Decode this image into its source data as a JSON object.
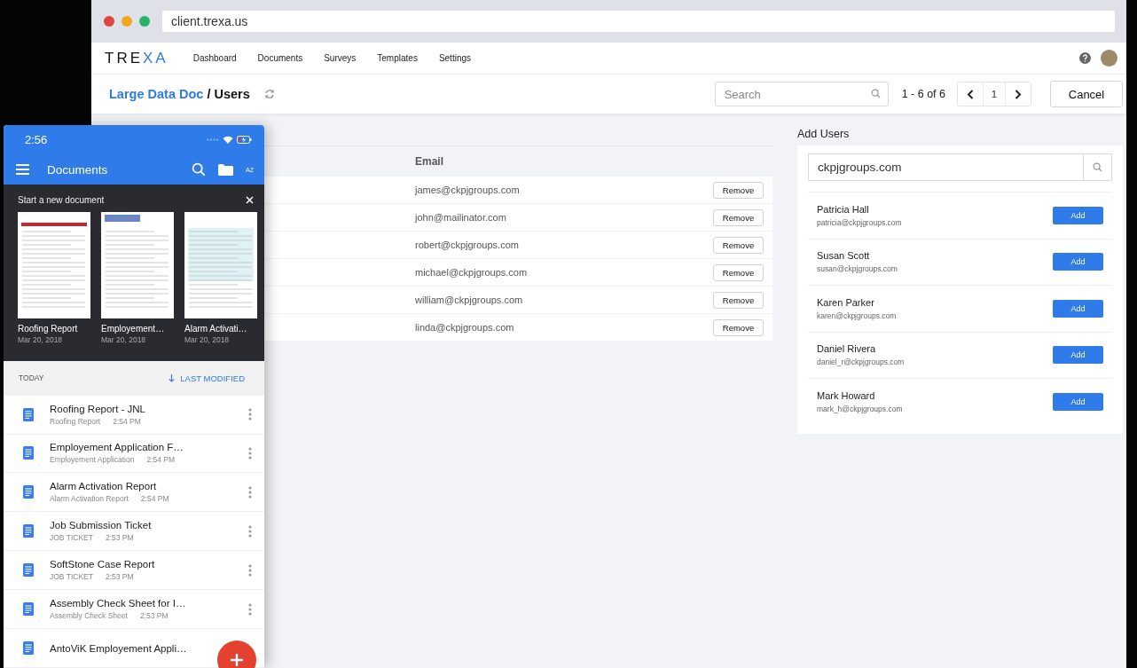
{
  "browser": {
    "url": "client.trexa.us"
  },
  "app": {
    "logo": "TREXA",
    "nav": [
      "Dashboard",
      "Documents",
      "Surveys",
      "Templates",
      "Settings"
    ]
  },
  "header": {
    "breadcrumb_link": "Large Data Doc",
    "breadcrumb_current": "/ Users",
    "search_placeholder": "Search",
    "page_range": "1 - 6 of 6",
    "page": "1",
    "cancel": "Cancel"
  },
  "assigned": {
    "column": "Email",
    "rows": [
      {
        "email": "james@ckpjgroups.com",
        "action": "Remove"
      },
      {
        "email": "john@mailinator.com",
        "action": "Remove"
      },
      {
        "email": "robert@ckpjgroups.com",
        "action": "Remove"
      },
      {
        "email": "michael@ckpjgroups.com",
        "action": "Remove"
      },
      {
        "email": "william@ckpjgroups.com",
        "action": "Remove"
      },
      {
        "email": "linda@ckpjgroups.com",
        "action": "Remove"
      }
    ]
  },
  "add_users": {
    "title": "Add Users",
    "search_value": "ckpjgroups.com",
    "users": [
      {
        "name": "Patricia Hall",
        "email": "patricia@ckpjgroups.com",
        "action": "Add"
      },
      {
        "name": "Susan Scott",
        "email": "susan@ckpjgroups.com",
        "action": "Add"
      },
      {
        "name": "Karen Parker",
        "email": "karen@ckpjgroups.com",
        "action": "Add"
      },
      {
        "name": "Daniel Rivera",
        "email": "daniel_r@ckpjgroups.com",
        "action": "Add"
      },
      {
        "name": "Mark Howard",
        "email": "mark_h@ckpjgroups.com",
        "action": "Add"
      }
    ]
  },
  "phone": {
    "time": "2:56",
    "title": "Documents",
    "sort_label": "AZ",
    "banner": {
      "title": "Start a new document",
      "templates": [
        {
          "name": "Roofing Report",
          "date": "Mar 20, 2018"
        },
        {
          "name": "Employement…",
          "date": "Mar 20, 2018"
        },
        {
          "name": "Alarm Activati…",
          "date": "Mar 20, 2018"
        }
      ]
    },
    "section": "TODAY",
    "sort": "LAST MODIFIED",
    "documents": [
      {
        "title": "Roofing Report - JNL",
        "type": "Roofing Report",
        "time": "2:54 PM"
      },
      {
        "title": "Employement Application F…",
        "type": "Employement Application",
        "time": "2:54 PM"
      },
      {
        "title": "Alarm Activation Report",
        "type": "Alarm Activation Report",
        "time": "2:54 PM"
      },
      {
        "title": "Job Submission Ticket",
        "type": "JOB TICKET",
        "time": "2:53 PM"
      },
      {
        "title": "SoftStone Case Report",
        "type": "JOB TICKET",
        "time": "2:53 PM"
      },
      {
        "title": "Assembly Check Sheet for I…",
        "type": "Assembly Check Sheet",
        "time": "2:53 PM"
      },
      {
        "title": "AntoViK Employement Appli…"
      }
    ]
  }
}
